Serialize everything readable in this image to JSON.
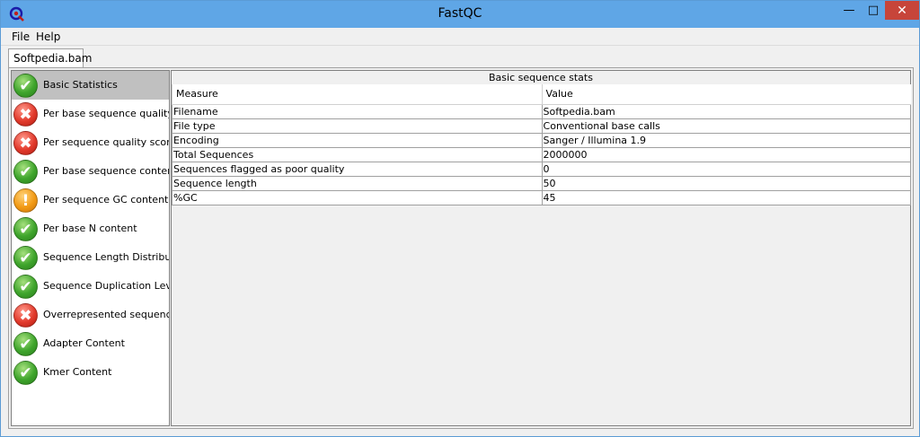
{
  "window": {
    "title": "FastQC",
    "minimize_glyph": "—",
    "maximize_glyph": "□",
    "close_glyph": "✕"
  },
  "menu": {
    "file": "File",
    "help": "Help"
  },
  "tab": {
    "label": "Softpedia.bam"
  },
  "modules": [
    {
      "label": "Basic Statistics",
      "status": "pass",
      "selected": true
    },
    {
      "label": "Per base sequence quality",
      "status": "fail"
    },
    {
      "label": "Per sequence quality scores",
      "status": "fail"
    },
    {
      "label": "Per base sequence content",
      "status": "pass"
    },
    {
      "label": "Per sequence GC content",
      "status": "warn"
    },
    {
      "label": "Per base N content",
      "status": "pass"
    },
    {
      "label": "Sequence Length Distribution",
      "status": "pass"
    },
    {
      "label": "Sequence Duplication Levels",
      "status": "pass"
    },
    {
      "label": "Overrepresented sequences",
      "status": "fail"
    },
    {
      "label": "Adapter Content",
      "status": "pass"
    },
    {
      "label": "Kmer Content",
      "status": "pass"
    }
  ],
  "stats": {
    "title": "Basic sequence stats",
    "headers": {
      "measure": "Measure",
      "value": "Value"
    },
    "rows": [
      {
        "measure": "Filename",
        "value": "Softpedia.bam"
      },
      {
        "measure": "File type",
        "value": "Conventional base calls"
      },
      {
        "measure": "Encoding",
        "value": "Sanger / Illumina 1.9"
      },
      {
        "measure": "Total Sequences",
        "value": "2000000"
      },
      {
        "measure": "Sequences flagged as poor quality",
        "value": "0"
      },
      {
        "measure": "Sequence length",
        "value": "50"
      },
      {
        "measure": "%GC",
        "value": "45"
      }
    ]
  },
  "icons": {
    "pass": "✔",
    "fail": "✖",
    "warn": "!"
  },
  "colors": {
    "titlebar": "#5fa6e6",
    "close": "#c7453a",
    "selected": "#c0c0c0"
  }
}
